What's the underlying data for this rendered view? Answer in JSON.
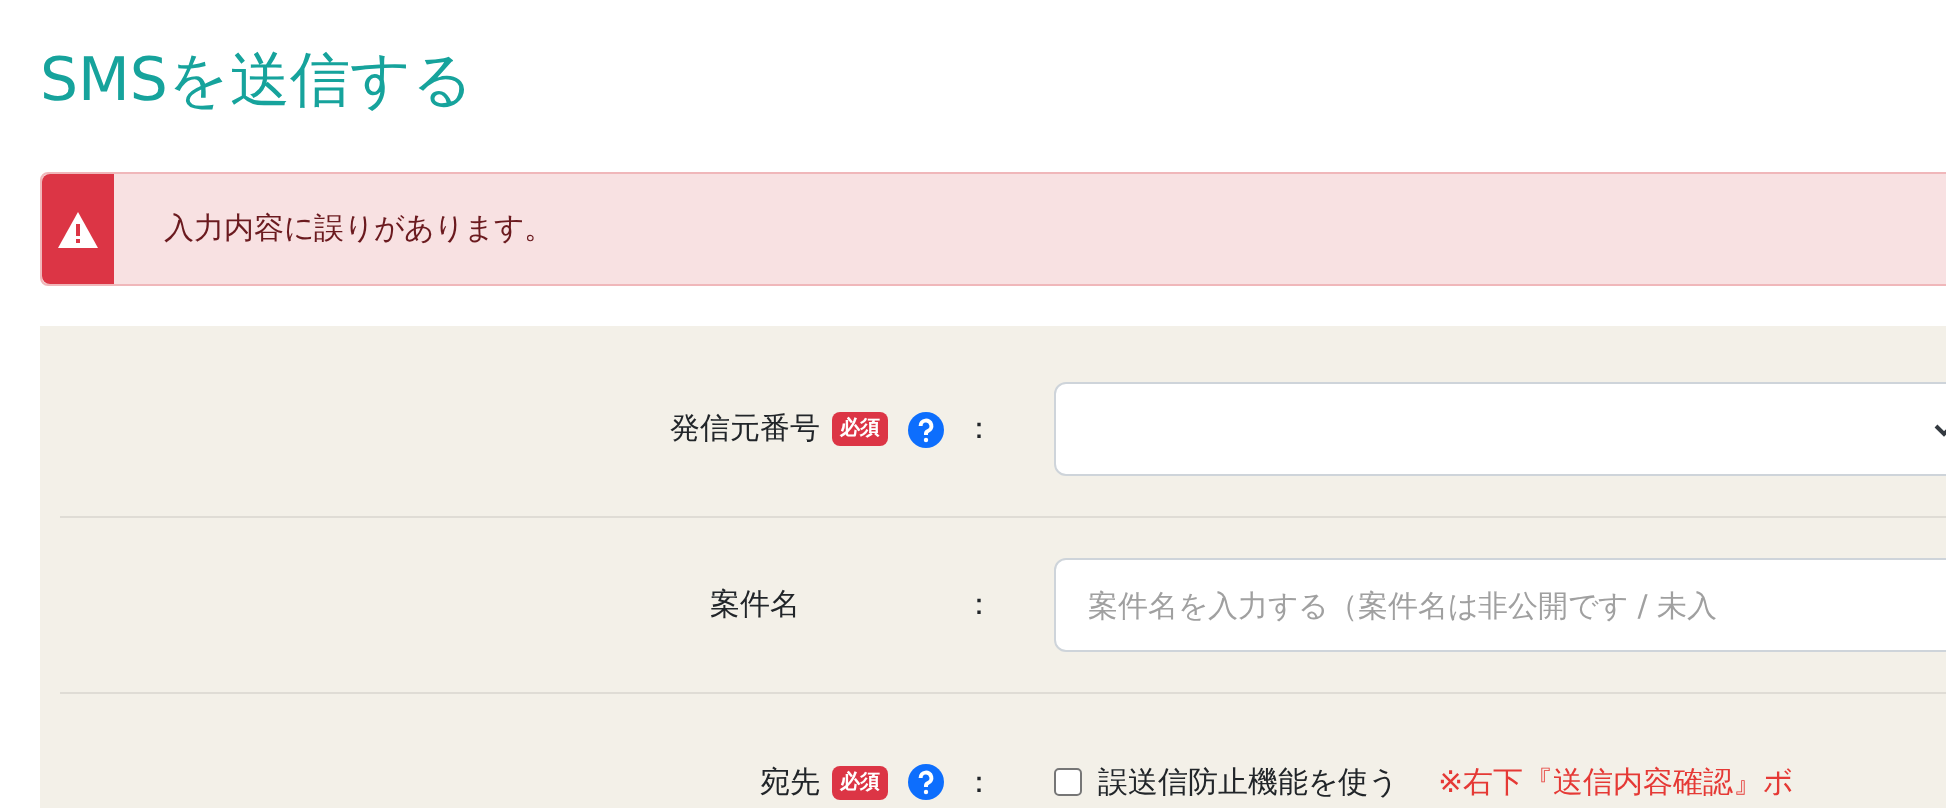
{
  "title": "SMSを送信する",
  "alert": {
    "message": "入力内容に誤りがあります。"
  },
  "form": {
    "rows": [
      {
        "kind": "select",
        "label": "発信元番号",
        "required": true,
        "required_badge": "必須",
        "help": true,
        "colon": "："
      },
      {
        "kind": "text",
        "label": "案件名",
        "required": false,
        "help": false,
        "colon": "：",
        "placeholder": "案件名を入力する（案件名は非公開です / 未入"
      },
      {
        "kind": "checkbox",
        "label": "宛先",
        "required": true,
        "required_badge": "必須",
        "help": true,
        "colon": "：",
        "checkbox_label": "誤送信防止機能を使う",
        "checked": false,
        "note": "※右下『送信内容確認』ボ"
      }
    ]
  }
}
